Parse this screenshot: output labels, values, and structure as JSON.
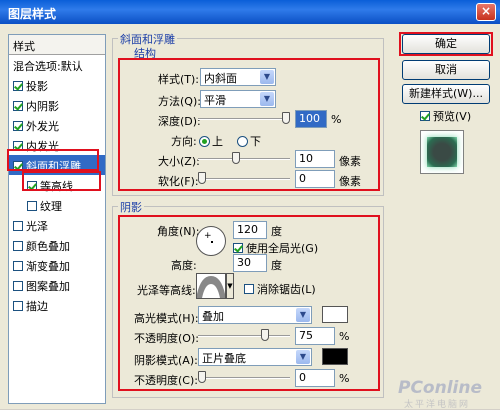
{
  "window": {
    "title": "图层样式",
    "close": "×"
  },
  "styles": {
    "header": "样式",
    "blend_options": "混合选项:默认",
    "items": [
      {
        "label": "投影",
        "checked": true
      },
      {
        "label": "内阴影",
        "checked": true
      },
      {
        "label": "外发光",
        "checked": true
      },
      {
        "label": "内发光",
        "checked": true
      },
      {
        "label": "斜面和浮雕",
        "checked": true,
        "selected": true
      },
      {
        "label": "等高线",
        "checked": true,
        "sub": true
      },
      {
        "label": "纹理",
        "checked": false,
        "sub": true
      },
      {
        "label": "光泽",
        "checked": false
      },
      {
        "label": "颜色叠加",
        "checked": false
      },
      {
        "label": "渐变叠加",
        "checked": false
      },
      {
        "label": "图案叠加",
        "checked": false
      },
      {
        "label": "描边",
        "checked": false
      }
    ]
  },
  "bevel": {
    "title": "斜面和浮雕",
    "structure_title": "结构",
    "style_label": "样式(T):",
    "style_value": "内斜面",
    "technique_label": "方法(Q):",
    "technique_value": "平滑",
    "depth_label": "深度(D):",
    "depth_value": "100",
    "depth_unit": "%",
    "depth_level": 1.0,
    "direction_label": "方向:",
    "dir_up": "上",
    "dir_down": "下",
    "size_label": "大小(Z):",
    "size_value": "10",
    "size_unit": "像素",
    "size_level": 0.4,
    "soften_label": "软化(F):",
    "soften_value": "0",
    "soften_unit": "像素",
    "soften_level": 0.0
  },
  "shading": {
    "title": "阴影",
    "angle_label": "角度(N):",
    "angle_value": "120",
    "angle_unit": "度",
    "global_light_label": "使用全局光(G)",
    "global_light_checked": true,
    "altitude_label": "高度:",
    "altitude_value": "30",
    "altitude_unit": "度",
    "gloss_label": "光泽等高线:",
    "antialias_label": "消除锯齿(L)",
    "antialias_checked": false,
    "highlight_label": "高光模式(H):",
    "highlight_value": "叠加",
    "highlight_color": "#ffffff",
    "hl_opacity_label": "不透明度(O):",
    "hl_opacity_value": "75",
    "hl_opacity_unit": "%",
    "hl_opacity_level": 0.75,
    "shadow_label": "阴影模式(A):",
    "shadow_value": "正片叠底",
    "shadow_color": "#000000",
    "sh_opacity_label": "不透明度(C):",
    "sh_opacity_value": "0",
    "sh_opacity_unit": "%",
    "sh_opacity_level": 0.0
  },
  "buttons": {
    "ok": "确定",
    "cancel": "取消",
    "new_style": "新建样式(W)...",
    "preview_label": "预览(V)",
    "preview_checked": true
  },
  "watermark": "PConline",
  "watermark_sub": "太平洋电脑网"
}
